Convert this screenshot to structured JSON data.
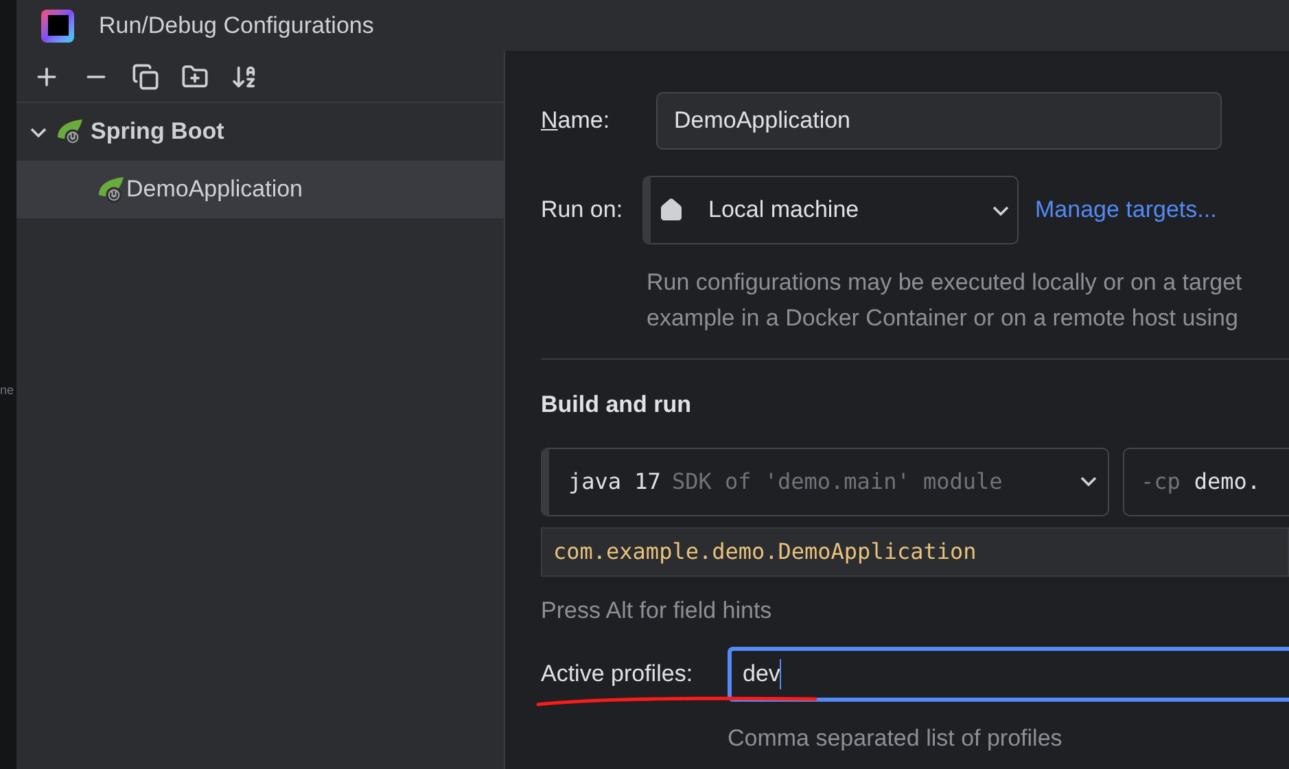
{
  "window": {
    "title": "Run/Debug Configurations"
  },
  "background_text": "ne",
  "toolbar": {
    "buttons": [
      {
        "kind": "add"
      },
      {
        "kind": "remove"
      },
      {
        "kind": "copy"
      },
      {
        "kind": "new-folder"
      },
      {
        "kind": "sort"
      }
    ]
  },
  "tree": [
    {
      "label": "Spring Boot",
      "expanded": true,
      "selected": false,
      "children": [
        {
          "label": "DemoApplication",
          "selected": true
        }
      ]
    }
  ],
  "name_field": {
    "label": "Name:",
    "mnemonic": true,
    "value": "DemoApplication"
  },
  "run_on": {
    "label": "Run on:",
    "value": "Local machine",
    "link": "Manage targets...",
    "description": [
      "Run configurations may be executed locally or on a target",
      "example in a Docker Container or on a remote host using"
    ]
  },
  "build_and_run": {
    "title": "Build and run",
    "jdk": {
      "name": "java 17",
      "detail": "SDK of 'demo.main' module"
    },
    "classpath": {
      "flag": "-cp",
      "value": "demo."
    },
    "main_class": "com.example.demo.DemoApplication",
    "hint": "Press Alt for field hints"
  },
  "active_profiles": {
    "label": "Active profiles:",
    "value": "dev",
    "focused": true,
    "annotated": true,
    "help": "Comma separated list of profiles"
  }
}
